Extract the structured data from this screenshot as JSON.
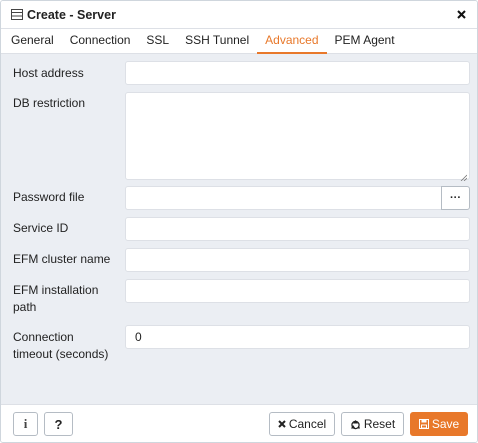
{
  "dialog": {
    "title": "Create - Server",
    "close_icon": "close-icon",
    "title_icon": "server-icon"
  },
  "tabs": [
    {
      "label": "General",
      "active": false
    },
    {
      "label": "Connection",
      "active": false
    },
    {
      "label": "SSL",
      "active": false
    },
    {
      "label": "SSH Tunnel",
      "active": false
    },
    {
      "label": "Advanced",
      "active": true
    },
    {
      "label": "PEM Agent",
      "active": false
    }
  ],
  "form": {
    "host_address": {
      "label": "Host address",
      "value": ""
    },
    "db_restriction": {
      "label": "DB restriction",
      "value": ""
    },
    "password_file": {
      "label": "Password file",
      "value": "",
      "browse_label": "···"
    },
    "service_id": {
      "label": "Service ID",
      "value": ""
    },
    "efm_cluster_name": {
      "label": "EFM cluster name",
      "value": ""
    },
    "efm_installation_path": {
      "label_line1": "EFM installation",
      "label_line2": "path",
      "value": ""
    },
    "connection_timeout": {
      "label_line1": "Connection",
      "label_line2": "timeout (seconds)",
      "value": "0"
    }
  },
  "footer": {
    "info_label": "i",
    "help_label": "?",
    "cancel_label": "Cancel",
    "reset_label": "Reset",
    "save_label": "Save"
  },
  "colors": {
    "accent": "#e8782a",
    "content_bg": "#ebeef3",
    "border": "#dde0e6"
  }
}
